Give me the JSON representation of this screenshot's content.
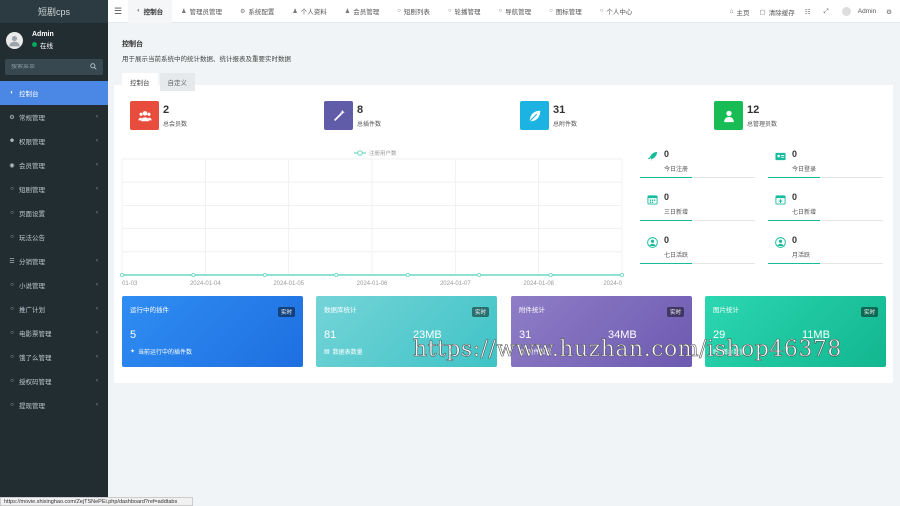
{
  "app": {
    "logo": "短剧cps"
  },
  "user": {
    "name": "Admin",
    "status": "在线"
  },
  "search": {
    "placeholder": "搜索菜单"
  },
  "sidebar": {
    "items": [
      {
        "label": "控制台",
        "icon": "dashboard-icon",
        "active": true
      },
      {
        "label": "常规管理",
        "icon": "cogs-icon",
        "arrow": true
      },
      {
        "label": "权限管理",
        "icon": "group-icon",
        "arrow": true
      },
      {
        "label": "会员管理",
        "icon": "user-circle-icon",
        "arrow": true
      },
      {
        "label": "短剧管理",
        "icon": "circle-icon",
        "arrow": true
      },
      {
        "label": "页面设置",
        "icon": "circle-icon",
        "arrow": true
      },
      {
        "label": "玩法公告",
        "icon": "circle-icon",
        "arrow": false
      },
      {
        "label": "分销管理",
        "icon": "list-icon",
        "arrow": true
      },
      {
        "label": "小说管理",
        "icon": "circle-icon",
        "arrow": true
      },
      {
        "label": "推广计划",
        "icon": "circle-icon",
        "arrow": true
      },
      {
        "label": "电影票管理",
        "icon": "circle-icon",
        "arrow": true
      },
      {
        "label": "饿了么管理",
        "icon": "circle-icon",
        "arrow": true
      },
      {
        "label": "授权码管理",
        "icon": "circle-icon",
        "arrow": true
      },
      {
        "label": "提现管理",
        "icon": "circle-icon",
        "arrow": true
      }
    ]
  },
  "topbar": {
    "tabs": [
      {
        "label": "控制台",
        "icon": "dashboard-icon",
        "active": true
      },
      {
        "label": "管理员管理",
        "icon": "user-icon"
      },
      {
        "label": "系统配置",
        "icon": "cog-icon"
      },
      {
        "label": "个人资料",
        "icon": "user-icon"
      },
      {
        "label": "会员管理",
        "icon": "user-icon"
      },
      {
        "label": "短剧列表",
        "icon": "circle-icon"
      },
      {
        "label": "轮播管理",
        "icon": "circle-icon"
      },
      {
        "label": "导航管理",
        "icon": "circle-icon"
      },
      {
        "label": "图标管理",
        "icon": "circle-icon"
      },
      {
        "label": "个人中心",
        "icon": "circle-icon"
      }
    ],
    "home": "主页",
    "clear_cache": "清除缓存",
    "admin": "Admin"
  },
  "panel": {
    "title": "控制台",
    "description": "用于展示当前系统中的统计数据、统计报表及重要实时数据",
    "tabs": [
      {
        "label": "控制台",
        "active": true
      },
      {
        "label": "自定义",
        "active": false
      }
    ]
  },
  "stats": [
    {
      "value": "2",
      "label": "总会员数",
      "color": "#e74c3c",
      "icon": "users-icon"
    },
    {
      "value": "8",
      "label": "总插件数",
      "color": "#605ca8",
      "icon": "magic-icon"
    },
    {
      "value": "31",
      "label": "总附件数",
      "color": "#1cb3e3",
      "icon": "leaf-icon"
    },
    {
      "value": "12",
      "label": "总管理员数",
      "color": "#18bc54",
      "icon": "user-icon"
    }
  ],
  "chart_data": {
    "type": "line",
    "series": [
      {
        "name": "注册用户数",
        "values": [
          0,
          0,
          0,
          0,
          0,
          0,
          0,
          0
        ]
      }
    ],
    "x": [
      "01-03",
      "2024-01-04",
      "2024-01-05",
      "2024-01-06",
      "2024-01-07",
      "2024-01-08",
      "2024-0"
    ],
    "legend": "top-center",
    "grid": true,
    "color": "#6ad7c2"
  },
  "daily": [
    {
      "value": "0",
      "label": "今日注册",
      "icon": "rocket-icon"
    },
    {
      "value": "0",
      "label": "今日登录",
      "icon": "id-card-icon"
    },
    {
      "value": "0",
      "label": "三日新增",
      "icon": "calendar-icon"
    },
    {
      "value": "0",
      "label": "七日新增",
      "icon": "calendar-plus-icon"
    },
    {
      "value": "0",
      "label": "七日活跃",
      "icon": "user-circle-icon"
    },
    {
      "value": "0",
      "label": "月活跃",
      "icon": "user-circle-icon"
    }
  ],
  "cards": [
    {
      "title": "运行中的插件",
      "badge": "实时",
      "num1": "5",
      "num2": "",
      "foot": "当前运行中的插件数",
      "color_from": "#2f8df3",
      "color_to": "#1e6fe0"
    },
    {
      "title": "数据库统计",
      "badge": "实时",
      "num1": "81",
      "num2": "23MB",
      "foot": "数据表数量",
      "color_from": "#74d4d8",
      "color_to": "#3fc3c6"
    },
    {
      "title": "附件统计",
      "badge": "实时",
      "num1": "31",
      "num2": "34MB",
      "foot": "附件数量",
      "color_from": "#8e7dc6",
      "color_to": "#6d5ab1"
    },
    {
      "title": "图片统计",
      "badge": "实时",
      "num1": "29",
      "num2": "11MB",
      "foot": "图片数量",
      "color_from": "#2bd7b1",
      "color_to": "#12b68f"
    }
  ],
  "watermark": "https://www.huzhan.com/ishop46378",
  "statusbar": "https://movie.shixinghao.com/ZejTSNePEi.php/dashboard?ref=addtabs"
}
